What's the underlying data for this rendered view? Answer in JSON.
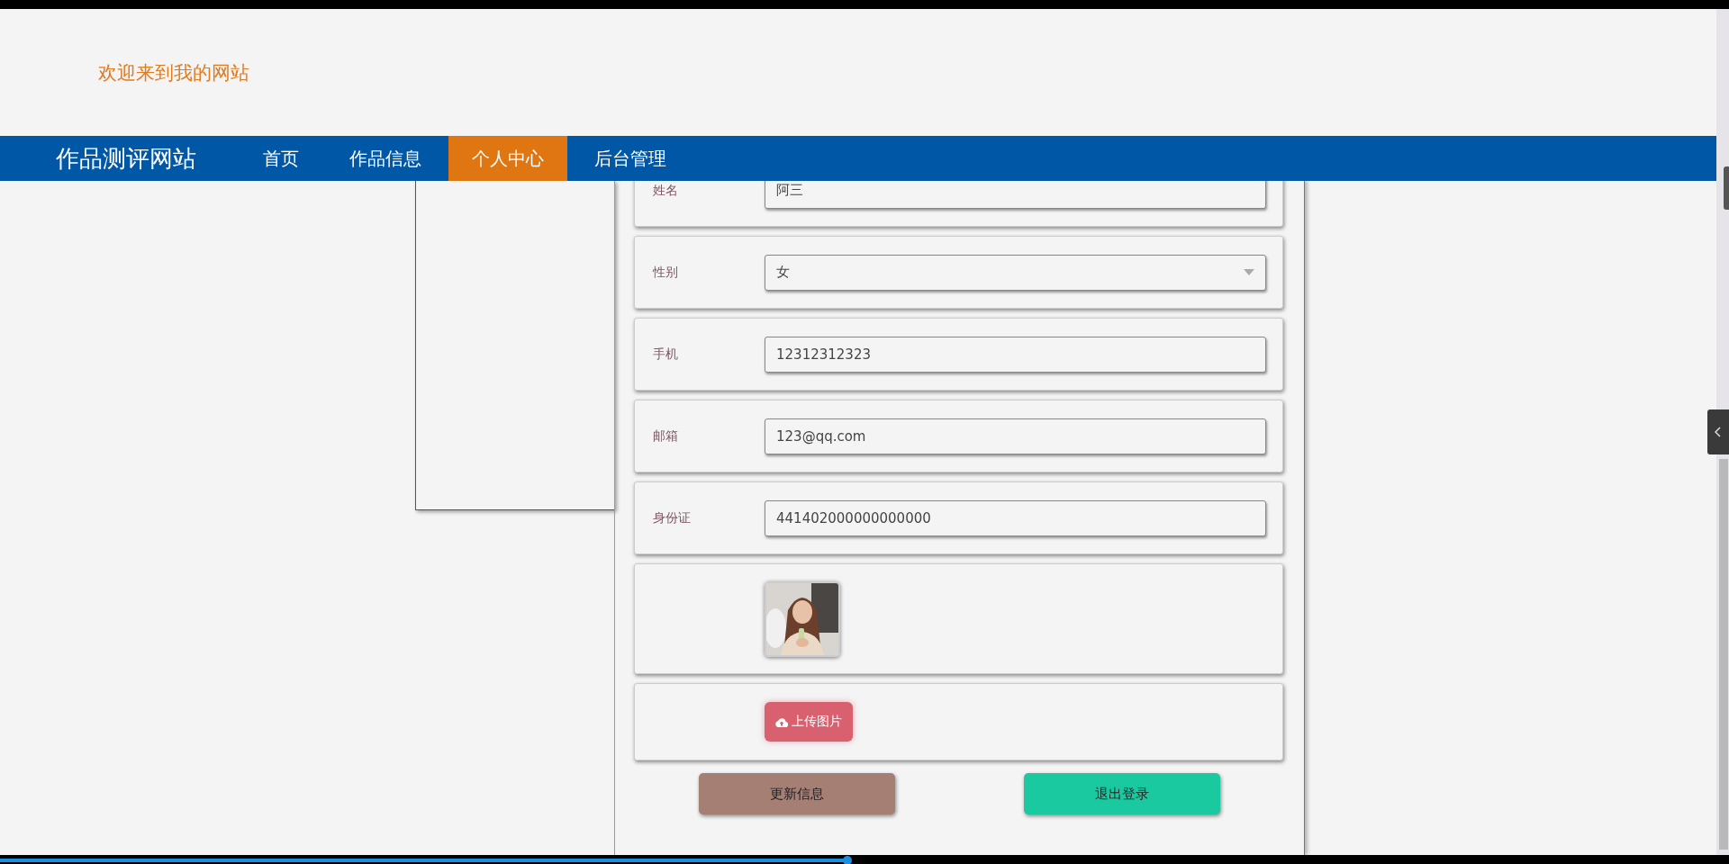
{
  "header": {
    "welcome": "欢迎来到我的网站"
  },
  "nav": {
    "brand": "作品测评网站",
    "items": [
      {
        "label": "首页",
        "selected": false
      },
      {
        "label": "作品信息",
        "selected": false
      },
      {
        "label": "个人中心",
        "selected": true
      },
      {
        "label": "后台管理",
        "selected": false
      }
    ]
  },
  "form": {
    "fields": [
      {
        "kind": "text",
        "label": "姓名",
        "value": "阿三"
      },
      {
        "kind": "select",
        "label": "性别",
        "value": "女"
      },
      {
        "kind": "text",
        "label": "手机",
        "value": "12312312323"
      },
      {
        "kind": "text",
        "label": "邮箱",
        "value": "123@qq.com"
      },
      {
        "kind": "text",
        "label": "身份证",
        "value": "441402000000000000"
      },
      {
        "kind": "avatar"
      },
      {
        "kind": "upload",
        "button": "上传图片"
      }
    ],
    "buttons": [
      {
        "label": "更新信息",
        "kind": "update"
      },
      {
        "label": "退出登录",
        "kind": "logout"
      }
    ]
  },
  "player": {
    "level": 0.49
  }
}
